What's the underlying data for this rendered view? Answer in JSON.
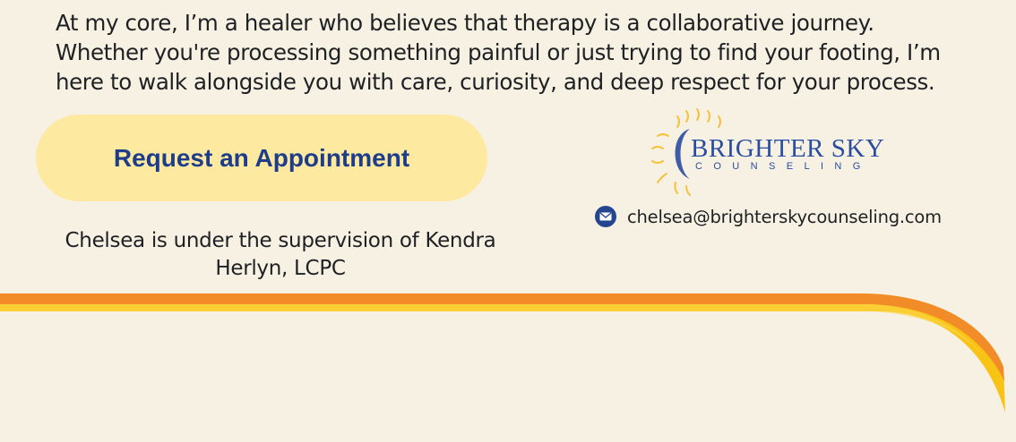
{
  "intro": {
    "line1": "At my core, I’m a healer who believes that therapy is a collaborative journey.",
    "line2": "Whether you're processing something painful or just trying to find your footing, I’m",
    "line3": "here to walk alongside you with care, curiosity, and deep respect for your process."
  },
  "cta": {
    "label": "Request an Appointment"
  },
  "supervision": {
    "line1": "Chelsea is under the supervision of Kendra",
    "line2": "Herlyn, LCPC"
  },
  "logo": {
    "wordmark": "BRIGHTER SKY",
    "subtitle": "COUNSELING",
    "icon": "sun-icon"
  },
  "contact": {
    "icon": "mail-icon",
    "email": "chelsea@brighterskycounseling.com"
  },
  "colors": {
    "background": "#f6f1e2",
    "button": "#fde9a0",
    "brand_blue": "#1d3d8b",
    "stripe_orange": "#f28c28",
    "stripe_yellow": "#f9c316"
  }
}
